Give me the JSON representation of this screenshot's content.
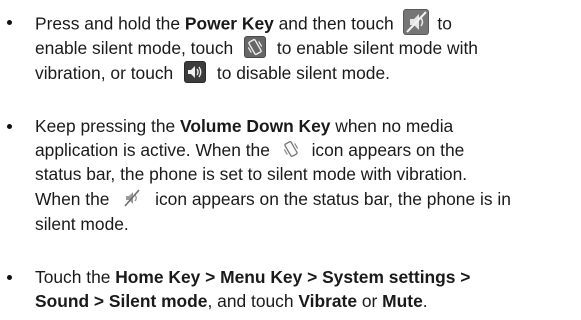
{
  "items": [
    {
      "lines": [
        [
          {
            "t": "Press and hold the "
          },
          {
            "t": "Power Key",
            "b": true
          },
          {
            "t": " and then touch "
          },
          {
            "icon": "silent-mode-icon"
          },
          {
            "t": " to"
          }
        ],
        [
          {
            "t": "enable silent mode, touch "
          },
          {
            "icon": "vibrate-mode-icon"
          },
          {
            "t": " to enable silent mode with"
          }
        ],
        [
          {
            "t": "vibration, or touch "
          },
          {
            "icon": "sound-on-icon"
          },
          {
            "t": " to disable silent mode."
          }
        ]
      ]
    },
    {
      "lines": [
        [
          {
            "t": "Keep pressing the "
          },
          {
            "t": "Volume Down Key",
            "b": true
          },
          {
            "t": " when no media"
          }
        ],
        [
          {
            "t": "application is active. When the "
          },
          {
            "icon": "vibrate-status-icon"
          },
          {
            "t": " icon appears on the"
          }
        ],
        [
          {
            "t": "status bar, the phone is set to silent mode with vibration."
          }
        ],
        [
          {
            "t": "When the "
          },
          {
            "icon": "silent-status-icon"
          },
          {
            "t": " icon appears on the status bar, the phone is in"
          }
        ],
        [
          {
            "t": "silent mode."
          }
        ]
      ]
    },
    {
      "lines": [
        [
          {
            "t": "Touch the "
          },
          {
            "t": "Home Key > Menu Key > System settings >",
            "b": true
          }
        ],
        [
          {
            "t": "Sound > Silent mode",
            "b": true
          },
          {
            "t": ", and touch "
          },
          {
            "t": "Vibrate",
            "b": true
          },
          {
            "t": " or "
          },
          {
            "t": "Mute",
            "b": true
          },
          {
            "t": "."
          }
        ]
      ]
    }
  ]
}
